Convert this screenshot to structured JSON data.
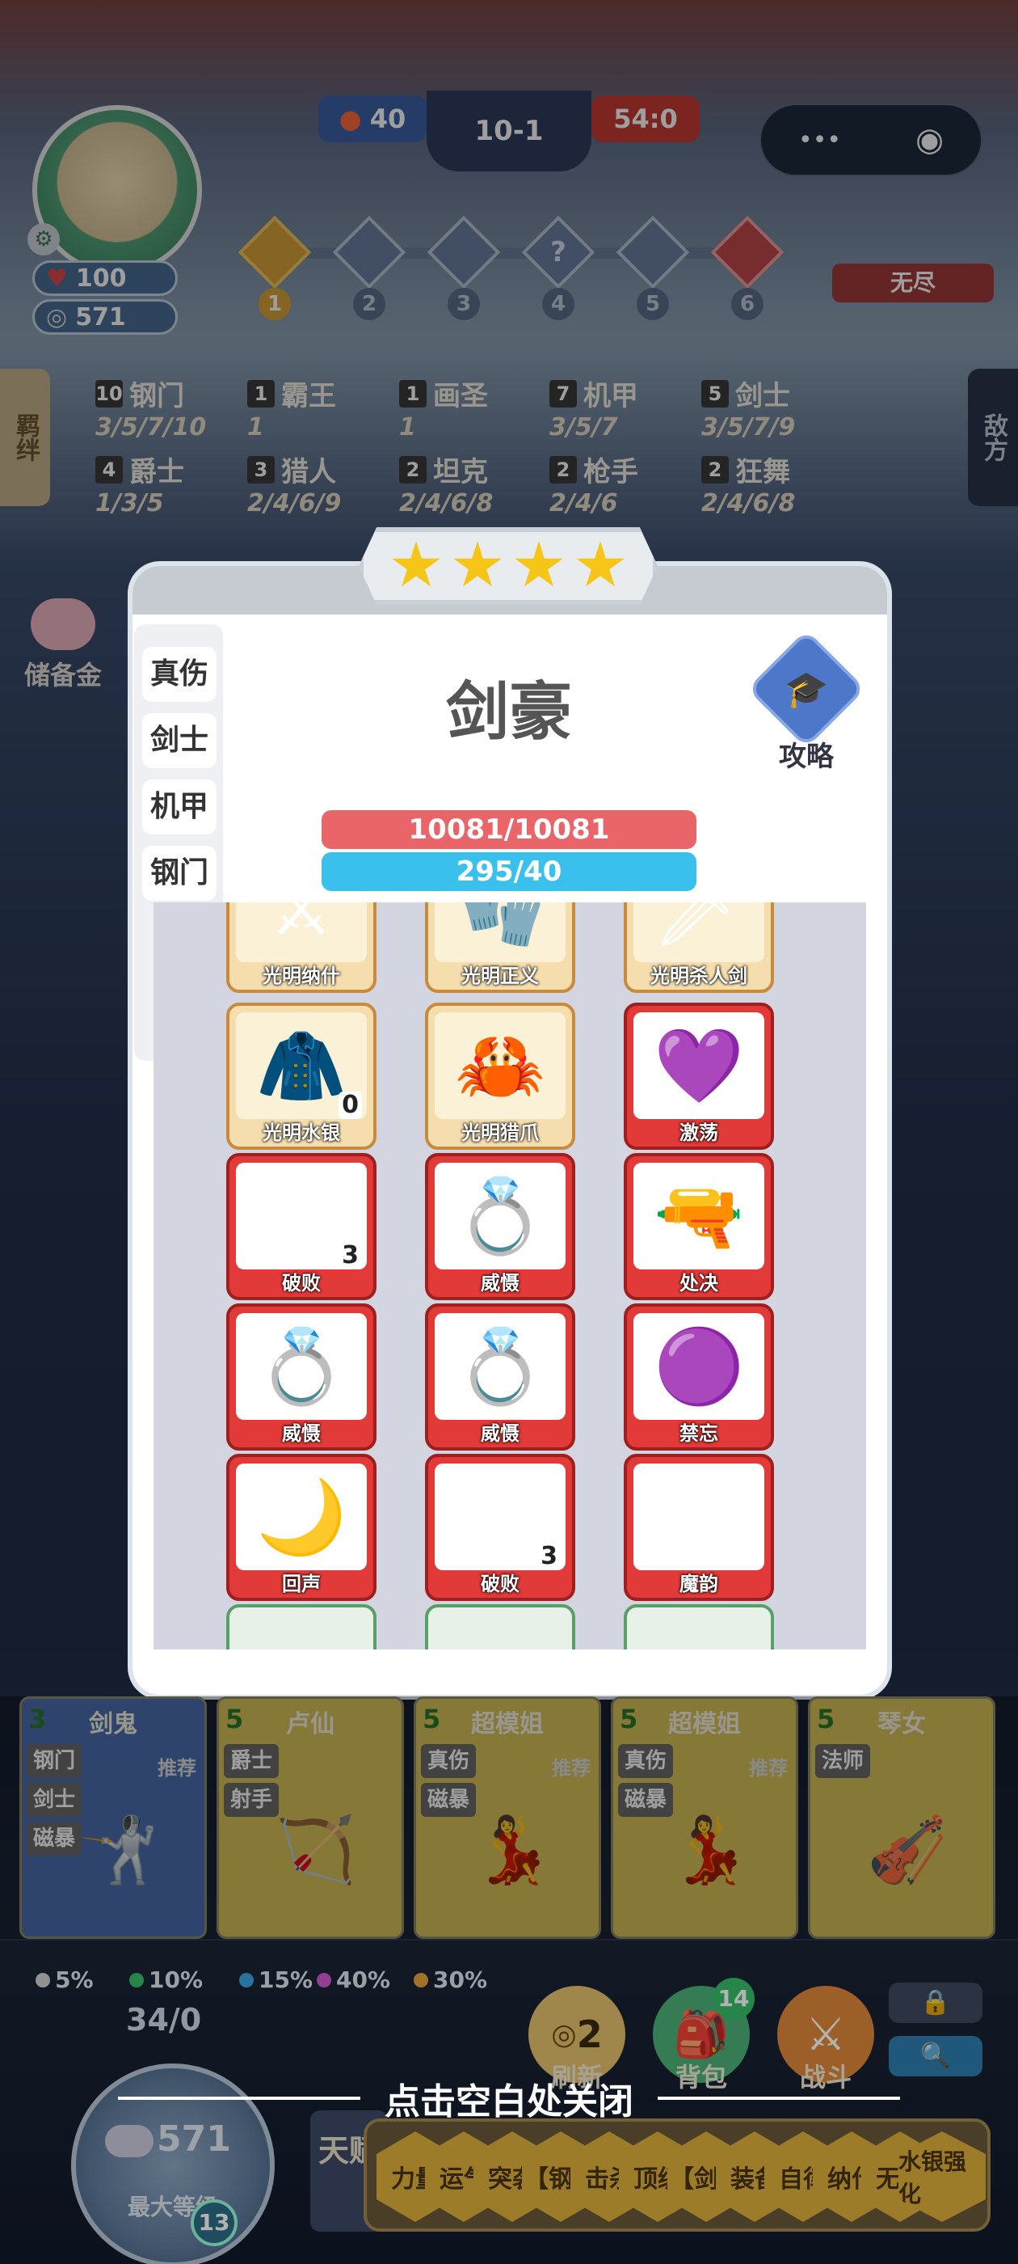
{
  "hud": {
    "hp": "100",
    "gold": "571",
    "score_left": "40",
    "round": "10-1",
    "score_right": "54:0",
    "menu_dots": "•••",
    "endless": "无尽",
    "stages": [
      "1",
      "2",
      "3",
      "4",
      "5",
      "6"
    ],
    "stage_mystery": "?"
  },
  "side": {
    "left_tab": "羁绊",
    "right_tab": "敌方",
    "piggy": "储备金"
  },
  "synergies": [
    {
      "count": "10",
      "name": "钢门",
      "tiers": "3/5/7/10"
    },
    {
      "count": "1",
      "name": "霸王",
      "tiers": "1"
    },
    {
      "count": "1",
      "name": "画圣",
      "tiers": "1"
    },
    {
      "count": "7",
      "name": "机甲",
      "tiers": "3/5/7"
    },
    {
      "count": "5",
      "name": "剑士",
      "tiers": "3/5/7/9"
    },
    {
      "count": "4",
      "name": "爵士",
      "tiers": "1/3/5"
    },
    {
      "count": "3",
      "name": "猎人",
      "tiers": "2/4/6/9"
    },
    {
      "count": "2",
      "name": "坦克",
      "tiers": "2/4/6/8"
    },
    {
      "count": "2",
      "name": "枪手",
      "tiers": "2/4/6"
    },
    {
      "count": "2",
      "name": "狂舞",
      "tiers": "2/4/6/8"
    }
  ],
  "modal": {
    "hero_name": "剑豪",
    "guide_label": "攻略",
    "hp_bar": "10081/10081",
    "mana_bar": "295/40",
    "tabs": [
      "真伤",
      "剑士",
      "机甲",
      "钢门"
    ],
    "items": [
      {
        "name": "光明纳什",
        "icon": "⚔",
        "color": "gold",
        "count": ""
      },
      {
        "name": "光明正义",
        "icon": "🧤",
        "color": "gold",
        "count": ""
      },
      {
        "name": "光明杀人剑",
        "icon": "🗡",
        "color": "gold",
        "count": ""
      },
      {
        "name": "光明水银",
        "icon": "🧥",
        "color": "gold",
        "count": "0"
      },
      {
        "name": "光明猎爪",
        "icon": "🦀",
        "color": "gold",
        "count": ""
      },
      {
        "name": "激荡",
        "icon": "💜",
        "color": "red",
        "count": ""
      },
      {
        "name": "破败",
        "icon": "🗡",
        "color": "red",
        "count": "3"
      },
      {
        "name": "威慑",
        "icon": "💍",
        "color": "red",
        "count": ""
      },
      {
        "name": "处决",
        "icon": "🔫",
        "color": "red",
        "count": ""
      },
      {
        "name": "威慑",
        "icon": "💍",
        "color": "red",
        "count": ""
      },
      {
        "name": "威慑",
        "icon": "💍",
        "color": "red",
        "count": ""
      },
      {
        "name": "禁忘",
        "icon": "🟣",
        "color": "red",
        "count": ""
      },
      {
        "name": "回声",
        "icon": "🌙",
        "color": "red",
        "count": ""
      },
      {
        "name": "破败",
        "icon": "🗡",
        "color": "red",
        "count": "3"
      },
      {
        "name": "魔韵",
        "icon": "❄",
        "color": "red",
        "count": ""
      }
    ],
    "close_hint": "点击空白处关闭"
  },
  "shop": [
    {
      "cost": "3",
      "name": "剑鬼",
      "tags": [
        "钢门",
        "剑士",
        "磁暴"
      ],
      "rec": "推荐",
      "style": "blue",
      "fig": "🤺"
    },
    {
      "cost": "5",
      "name": "卢仙",
      "tags": [
        "爵士",
        "射手"
      ],
      "rec": "",
      "style": "gold",
      "fig": "🏹"
    },
    {
      "cost": "5",
      "name": "超模姐",
      "tags": [
        "真伤",
        "磁暴"
      ],
      "rec": "推荐",
      "style": "gold",
      "fig": "💃"
    },
    {
      "cost": "5",
      "name": "超模姐",
      "tags": [
        "真伤",
        "磁暴"
      ],
      "rec": "推荐",
      "style": "gold",
      "fig": "💃"
    },
    {
      "cost": "5",
      "name": "琴女",
      "tags": [
        "法师"
      ],
      "rec": "",
      "style": "gold",
      "fig": "🎻"
    }
  ],
  "odds": [
    {
      "pct": "5%",
      "color": "#d0d0d0"
    },
    {
      "pct": "10%",
      "color": "#37c16a"
    },
    {
      "pct": "15%",
      "color": "#3aa7e6"
    },
    {
      "pct": "40%",
      "color": "#d35ad3"
    },
    {
      "pct": "30%",
      "color": "#e8a23a"
    }
  ],
  "bottom": {
    "exp": "34/0",
    "coin": "571",
    "max_level": "最大等级",
    "level": "13",
    "refresh_cost": "2",
    "refresh": "刷新",
    "bag_count": "14",
    "bag": "背包",
    "fight": "战斗",
    "talent": "天赋",
    "talents": [
      "力量",
      "运气",
      "突袭",
      "【钢】",
      "击杀",
      "顶级",
      "【剑】",
      "装备",
      "自律",
      "纳什",
      "无尽",
      "水银强化"
    ]
  }
}
